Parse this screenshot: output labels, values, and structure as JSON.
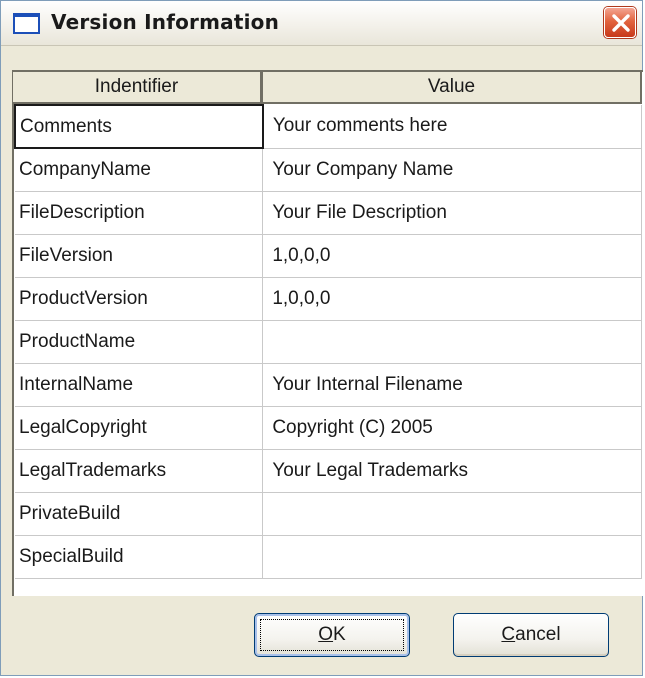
{
  "window": {
    "title": "Version Information",
    "icon": "window-icon",
    "close_icon": "close-icon",
    "close_color": "#e2643f"
  },
  "columns": {
    "identifier": "Indentifier",
    "value": "Value"
  },
  "rows": [
    {
      "id": "Comments",
      "value": "Your comments here"
    },
    {
      "id": "CompanyName",
      "value": "Your Company Name"
    },
    {
      "id": "FileDescription",
      "value": "Your File Description"
    },
    {
      "id": "FileVersion",
      "value": "1,0,0,0"
    },
    {
      "id": "ProductVersion",
      "value": "1,0,0,0"
    },
    {
      "id": "ProductName",
      "value": ""
    },
    {
      "id": "InternalName",
      "value": "Your Internal Filename"
    },
    {
      "id": "LegalCopyright",
      "value": "Copyright (C) 2005"
    },
    {
      "id": "LegalTrademarks",
      "value": "Your Legal Trademarks"
    },
    {
      "id": "PrivateBuild",
      "value": ""
    },
    {
      "id": "SpecialBuild",
      "value": ""
    }
  ],
  "buttons": {
    "ok": {
      "mnemonic": "O",
      "rest": "K"
    },
    "cancel": {
      "mnemonic": "C",
      "rest": "ancel"
    }
  }
}
